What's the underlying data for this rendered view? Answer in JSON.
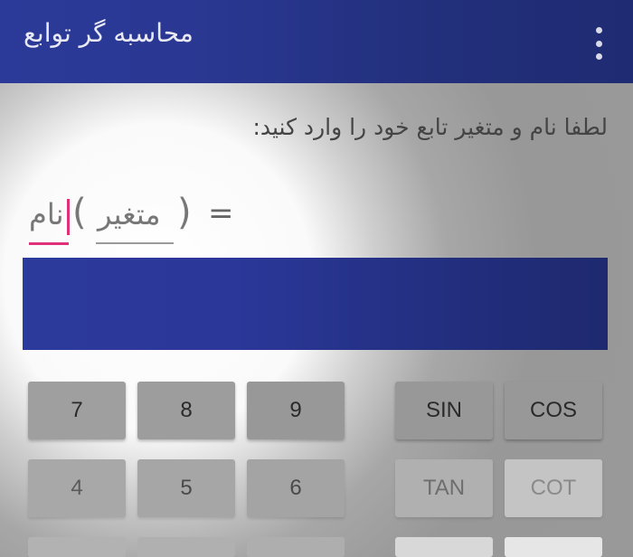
{
  "appbar": {
    "title": "محاسبه گر توابع"
  },
  "instruction": "لطفا نام و متغیر تابع خود را وارد کنید:",
  "function": {
    "name_value": "نام",
    "variable_value": "متغیر",
    "open_paren": "(",
    "close_paren": ")",
    "equals": "="
  },
  "keypad": {
    "row1": [
      "7",
      "8",
      "9"
    ],
    "row2": [
      "4",
      "5",
      "6"
    ],
    "trig_row1": [
      "SIN",
      "COS"
    ],
    "trig_row2": [
      "TAN",
      "COT"
    ]
  },
  "colors": {
    "primary": "#2b3a98",
    "accent": "#e0307a"
  }
}
